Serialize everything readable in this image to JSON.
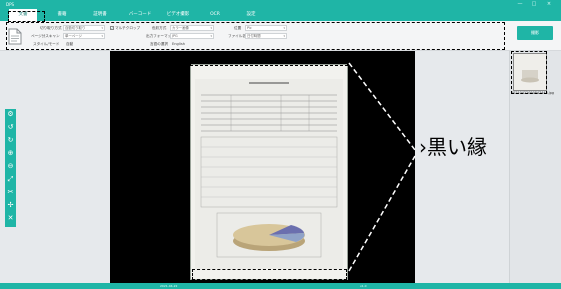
{
  "window": {
    "app_name": "DPS",
    "controls": {
      "minimize": "—",
      "maximize": "□",
      "close": "×"
    }
  },
  "menu": {
    "tabs": [
      {
        "label": "文書",
        "active": true
      },
      {
        "label": "書籍",
        "active": false
      },
      {
        "label": "証明書",
        "active": false
      },
      {
        "label": "バーコード",
        "active": false
      },
      {
        "label": "ビデオ撮影",
        "active": false
      },
      {
        "label": "OCR",
        "active": false
      },
      {
        "label": "設定",
        "active": false
      }
    ]
  },
  "toolbar": {
    "crop_label": "切り取り方式",
    "crop_value": "自動切り取り",
    "multi_label": "マルチクロップ",
    "multi_checked": true,
    "page_scan_label": "ページ分スキャン",
    "page_scan_value": "单一ページ",
    "rotate_label": "スタイル/モード",
    "rotate_value": "自動",
    "color_label": "色彩方式",
    "color_value": "カラー画像",
    "format_label": "出力フォーマット",
    "format_value": "JPG",
    "lang_label": "言語の選択",
    "lang_value": "English",
    "location_label": "位置",
    "location_value": "Pic",
    "filename_label": "ファイル名",
    "filename_value": "日付時間",
    "scan_button": "撮影"
  },
  "thumbnail": {
    "label": "20210422090847443.jpg"
  },
  "annotation": {
    "caption": "›黒い縁"
  },
  "statusbar": {
    "left_text": "2021-04-22",
    "right_text": "v1.0"
  },
  "colors": {
    "accent": "#1fb5a6",
    "viewer_bg": "#000000",
    "panel_bg": "#e2e5e8"
  },
  "icons": [
    "document-icon",
    "settings-icon",
    "rotate-left-icon",
    "rotate-right-icon",
    "zoom-in-icon",
    "zoom-out-icon",
    "fit-icon",
    "crop-icon",
    "delete-icon"
  ]
}
